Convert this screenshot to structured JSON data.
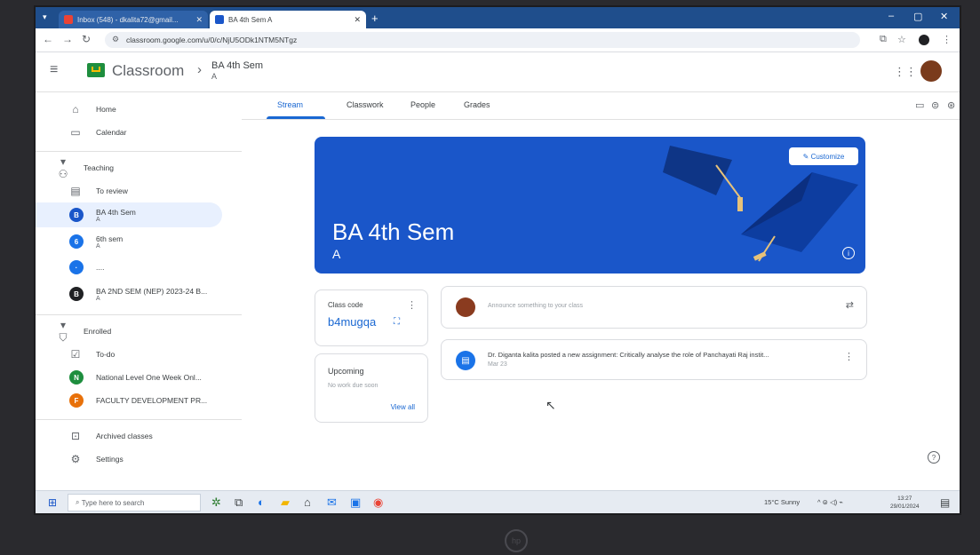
{
  "browser": {
    "tabs": [
      {
        "label": "Inbox (548) - dkalita72@gmail...",
        "favicon_color": "#ea4335"
      },
      {
        "label": "BA 4th Sem A",
        "favicon_color": "#1a56c9"
      }
    ],
    "url": "classroom.google.com/u/0/c/NjU5ODk1NTM5NTgz",
    "icons": {
      "tab_menu": "chevron-down-icon",
      "new_tab": "plus-icon",
      "minimize": "minimize-icon",
      "maximize": "maximize-icon",
      "close": "close-icon"
    }
  },
  "app": {
    "name": "Classroom",
    "breadcrumb": {
      "title": "BA 4th Sem",
      "subtitle": "A"
    },
    "brand_color": "#1e8e3e"
  },
  "sidebar": {
    "items": [
      {
        "label": "Home",
        "icon": "home-icon"
      },
      {
        "label": "Calendar",
        "icon": "calendar-icon"
      },
      {
        "label": "Teaching",
        "icon": "people-icon"
      },
      {
        "label": "To review",
        "icon": "review-icon"
      },
      {
        "label": "BA 4th Sem",
        "sub": "A",
        "initial": "B",
        "color": "#1a56c9"
      },
      {
        "label": "6th sem",
        "sub": "A",
        "initial": "6",
        "color": "#1a73e8"
      },
      {
        "label": "....",
        "initial": "·",
        "color": "#1a73e8"
      },
      {
        "label": "BA 2ND SEM (NEP) 2023-24 B...",
        "sub": "A",
        "initial": "B",
        "color": "#202124"
      },
      {
        "label": "Enrolled",
        "icon": "graduation-cap-icon"
      },
      {
        "label": "To-do",
        "icon": "checklist-icon"
      },
      {
        "label": "National Level One Week Onl...",
        "initial": "N",
        "color": "#1e8e3e"
      },
      {
        "label": "FACULTY DEVELOPMENT PR...",
        "initial": "F",
        "color": "#e8710a"
      },
      {
        "label": "Archived classes",
        "icon": "archive-icon"
      },
      {
        "label": "Settings",
        "icon": "gear-icon"
      }
    ]
  },
  "tabs": [
    {
      "label": "Stream"
    },
    {
      "label": "Classwork"
    },
    {
      "label": "People"
    },
    {
      "label": "Grades"
    }
  ],
  "banner": {
    "title": "BA 4th Sem",
    "section": "A",
    "customize_label": "Customize",
    "color": "#1a56c9"
  },
  "class_code": {
    "label": "Class code",
    "code": "b4mugqa"
  },
  "upcoming": {
    "label": "Upcoming",
    "empty": "No work due soon",
    "view_all": "View all"
  },
  "announce": {
    "placeholder": "Announce something to your class"
  },
  "post": {
    "text": "Dr. Diganta kalita posted a new assignment: Critically analyse the role of Panchayati Raj instit...",
    "date": "Mar 23"
  },
  "taskbar": {
    "search_placeholder": "Type here to search",
    "weather": "15°C Sunny",
    "time": "13:27",
    "date": "29/01/2024"
  }
}
